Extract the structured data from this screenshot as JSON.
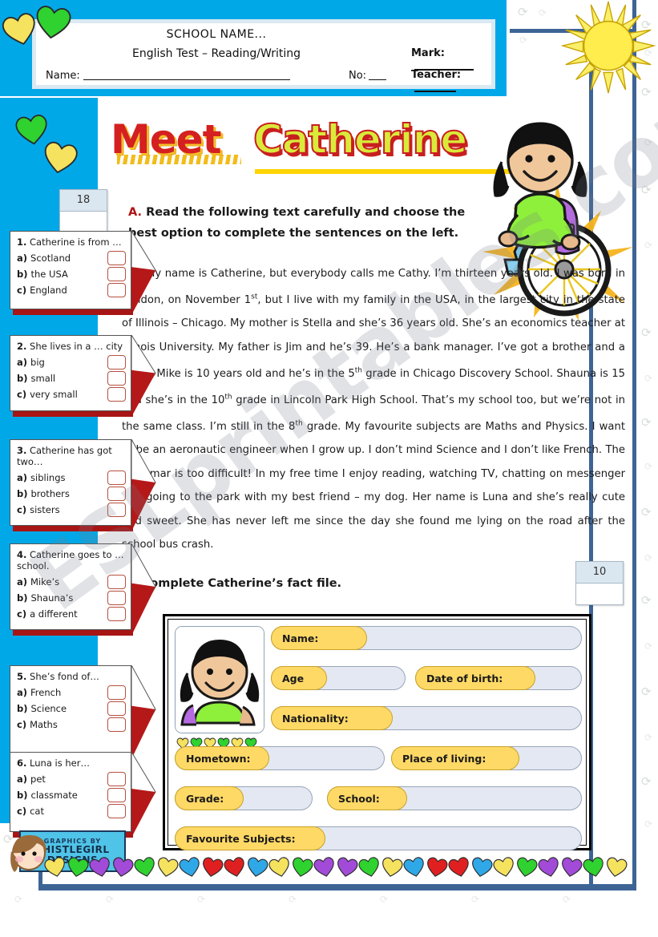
{
  "header": {
    "school_name": "SCHOOL NAME...",
    "test_title": "English Test – Reading/Writing",
    "name_label": "Name:",
    "no_label": "No:",
    "mark_label": "Mark:",
    "teacher_label": "Teacher:"
  },
  "title": {
    "word1": "Meet",
    "word2": "Catherine"
  },
  "scores": {
    "part_a": "18",
    "part_b": "10"
  },
  "instructions": {
    "a_label": "A.",
    "a_text": "Read the following text carefully and choose the best option to complete the sentences on the left.",
    "b_label": "B.",
    "b_text": "Complete Catherine’s fact file."
  },
  "reading_text": "My name is Catherine, but everybody calls me Cathy. I’m thirteen years old. I was born in London, on November 1st, but I live with my family in the USA, in the largest city in the state of Illinois – Chicago. My mother is Stella and she’s 36 years old. She’s an economics teacher at Illinois University. My father is Jim and he’s 39. He’s a bank manager. I’ve got a brother and a sister. Mike is 10 years old and he’s in the 5th grade in Chicago Discovery School. Shauna is 15 and she’s in the 10th grade in Lincoln Park High School. That’s my school too, but we’re not in the same class. I’m still in the 8th grade. My favourite subjects are Maths and Physics. I want to be an aeronautic engineer when I grow up. I don’t mind Science and I don’t like French. The grammar is too difficult! In my free time I enjoy reading, watching TV, chatting on messenger and going to the park with my best friend – my dog. Her name is Luna and she’s really cute and sweet. She has never left me since the day she found me lying on the road after the school bus crash.",
  "questions": [
    {
      "number": "1.",
      "prompt": "Catherine is from …",
      "options": [
        {
          "letter": "a)",
          "text": "Scotland"
        },
        {
          "letter": "b)",
          "text": "the USA"
        },
        {
          "letter": "c)",
          "text": "England"
        }
      ]
    },
    {
      "number": "2.",
      "prompt": "She lives in a … city",
      "options": [
        {
          "letter": "a)",
          "text": "big"
        },
        {
          "letter": "b)",
          "text": "small"
        },
        {
          "letter": "c)",
          "text": "very small"
        }
      ]
    },
    {
      "number": "3.",
      "prompt": "Catherine has got two…",
      "options": [
        {
          "letter": "a)",
          "text": "siblings"
        },
        {
          "letter": "b)",
          "text": "brothers"
        },
        {
          "letter": "c)",
          "text": "sisters"
        }
      ]
    },
    {
      "number": "4.",
      "prompt": "Catherine goes to … school.",
      "options": [
        {
          "letter": "a)",
          "text": "Mike’s"
        },
        {
          "letter": "b)",
          "text": "Shauna’s"
        },
        {
          "letter": "c)",
          "text": "a different"
        }
      ]
    },
    {
      "number": "5.",
      "prompt": "She’s fond of…",
      "options": [
        {
          "letter": "a)",
          "text": "French"
        },
        {
          "letter": "b)",
          "text": "Science"
        },
        {
          "letter": "c)",
          "text": "Maths"
        }
      ]
    },
    {
      "number": "6.",
      "prompt": "Luna is her…",
      "options": [
        {
          "letter": "a)",
          "text": "pet"
        },
        {
          "letter": "b)",
          "text": "classmate"
        },
        {
          "letter": "c)",
          "text": "cat"
        }
      ]
    }
  ],
  "fact_file": {
    "fields": [
      {
        "label": "Name:"
      },
      {
        "label": "Age"
      },
      {
        "label": "Date of birth:"
      },
      {
        "label": "Nationality:"
      },
      {
        "label": "Hometown:"
      },
      {
        "label": "Place of living:"
      },
      {
        "label": "Grade:"
      },
      {
        "label": "School:"
      },
      {
        "label": "Favourite Subjects:"
      }
    ]
  },
  "credit": {
    "line1": "GRAPHICS BY",
    "line2": "THISTLEGIRL",
    "line3": "DESIGNS"
  },
  "watermark": "ESLprintables.com",
  "colors": {
    "cyan": "#00a8e8",
    "frame_blue": "#3d6495",
    "red_arrow": "#c01818",
    "title_red": "#d42020",
    "title_yellow": "#d9ea3a",
    "pill_yellow": "#ffd966",
    "field_blue": "#e3e8f3"
  }
}
